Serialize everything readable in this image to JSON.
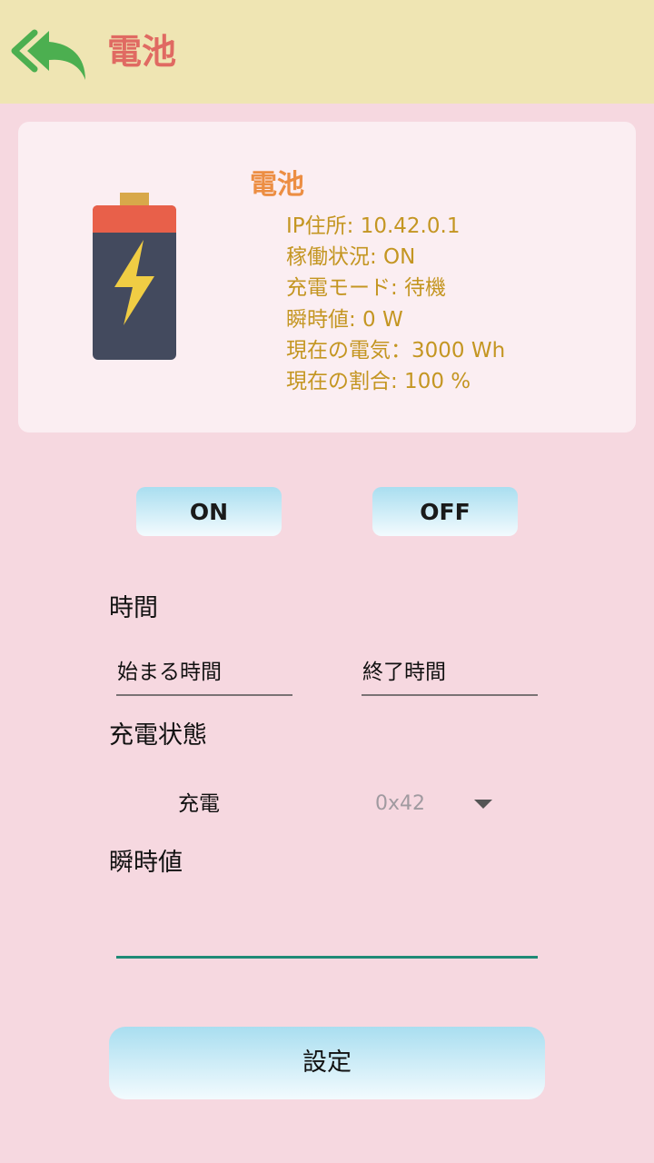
{
  "header": {
    "title": "電池",
    "back_icon": "back-arrow-icon",
    "back_icon_color": "#4caf50"
  },
  "device_card": {
    "title": "電池",
    "icon": "battery-charging-icon",
    "info": [
      "IP住所: 10.42.0.1",
      "稼働状況: ON",
      "充電モード: 待機",
      "瞬時値: 0 W",
      "現在の電気：3000 Wh",
      "現在の割合: 100 %"
    ]
  },
  "power_controls": {
    "on_label": "ON",
    "off_label": "OFF"
  },
  "time_section": {
    "label": "時間",
    "start_placeholder": "始まる時間",
    "end_placeholder": "終了時間"
  },
  "charge_section": {
    "label": "充電状態",
    "field_label": "充電",
    "selected_value": "0x42"
  },
  "instant_section": {
    "label": "瞬時値",
    "value": ""
  },
  "submit": {
    "label": "設定"
  },
  "colors": {
    "header_bg": "#efe5b3",
    "page_bg": "#f6d8e0",
    "card_bg": "#fbeef2",
    "title_red": "#e06a62",
    "card_title_orange": "#ec8e43",
    "info_gold": "#c49622",
    "input_underline": "#1f8a76"
  }
}
